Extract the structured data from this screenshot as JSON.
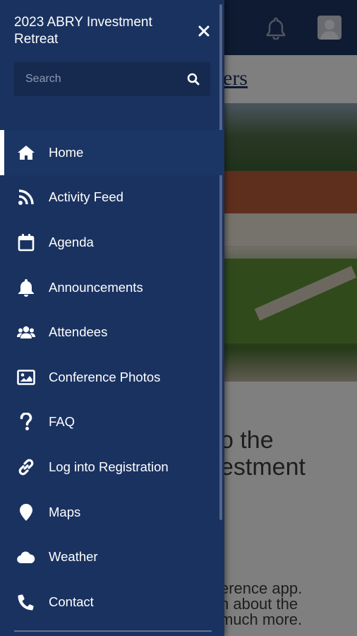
{
  "background": {
    "header_color": "#1d3461",
    "partial_link_text": "ers",
    "welcome_lines": [
      "o the",
      "estment"
    ],
    "description_lines": [
      "erence app.",
      "n about the",
      "much more."
    ]
  },
  "drawer": {
    "title": "2023 ABRY Investment Retreat",
    "close_icon": "close-icon",
    "search": {
      "placeholder": "Search",
      "value": "",
      "icon": "search-icon"
    },
    "items": [
      {
        "label": "Home",
        "icon": "home-icon",
        "active": true
      },
      {
        "label": "Activity Feed",
        "icon": "rss-icon",
        "active": false
      },
      {
        "label": "Agenda",
        "icon": "calendar-icon",
        "active": false
      },
      {
        "label": "Announcements",
        "icon": "bell-icon",
        "active": false
      },
      {
        "label": "Attendees",
        "icon": "users-icon",
        "active": false
      },
      {
        "label": "Conference Photos",
        "icon": "image-icon",
        "active": false
      },
      {
        "label": "FAQ",
        "icon": "question-icon",
        "active": false
      },
      {
        "label": "Log into Registration",
        "icon": "link-icon",
        "active": false
      },
      {
        "label": "Maps",
        "icon": "map-marker-icon",
        "active": false
      },
      {
        "label": "Weather",
        "icon": "cloud-icon",
        "active": false
      },
      {
        "label": "Contact",
        "icon": "phone-icon",
        "active": false
      }
    ],
    "colors": {
      "drawer_bg": "#1a3260",
      "active_indicator": "#ffffff",
      "text": "#ffffff"
    }
  }
}
